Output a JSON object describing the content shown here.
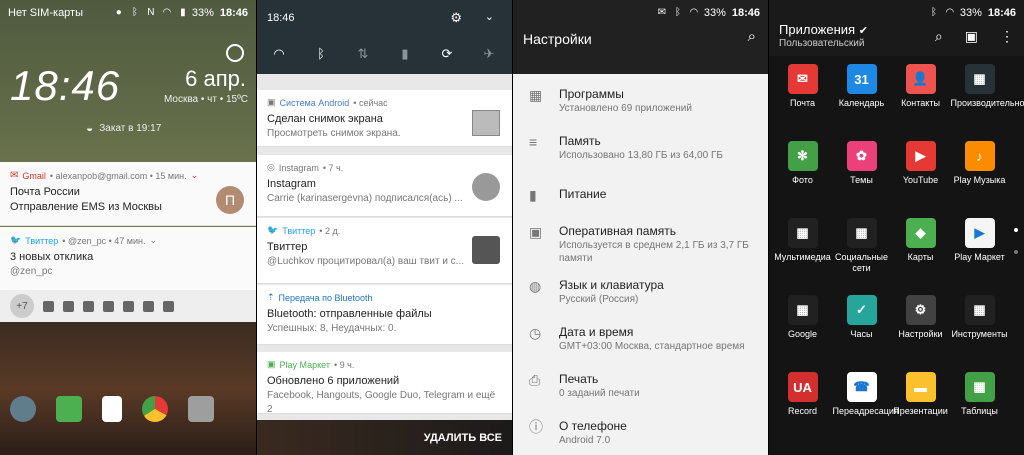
{
  "lock": {
    "status_left": "Нет SIM-карты",
    "battery": "33%",
    "time": "18:46",
    "clock": "18:46",
    "date": "6 апр.",
    "location": "Москва • чт • 15ºC",
    "sunset": "Закат в 19:17",
    "gmail": {
      "app": "Gmail",
      "meta": "• alexanpob@gmail.com • 15 мин.",
      "title": "Почта России",
      "text": "Отправление EMS из Москвы",
      "avatar": "П"
    },
    "twitter": {
      "app": "Твиттер",
      "meta": "• @zen_pc • 47 мин.",
      "title": "3 новых отклика",
      "text": "@zen_pc"
    },
    "more_count": "+7"
  },
  "shade": {
    "time": "18:46",
    "notifications": [
      {
        "app": "Система Android",
        "meta": "• сейчас",
        "title": "Сделан снимок экрана",
        "text": "Просмотреть снимок экрана."
      },
      {
        "app": "Instagram",
        "meta": "• 7 ч.",
        "title": "Instagram",
        "text": "Carrie (karinasergevna) подписался(ась) ..."
      },
      {
        "app": "Твиттер",
        "meta": "• 2 д.",
        "title": "Твиттер",
        "text": "@Luchkov процитировал(а) ваш твит и с..."
      },
      {
        "app": "Передача по Bluetooth",
        "meta": "",
        "title": "Bluetooth: отправленные файлы",
        "text": "Успешных: 8, Неудачных: 0."
      },
      {
        "app": "Play Маркет",
        "meta": "• 9 ч.",
        "title": "Обновлено 6 приложений",
        "text": "Facebook, Hangouts, Google Duo, Telegram и ещё 2"
      }
    ],
    "clear_all": "УДАЛИТЬ ВСЕ"
  },
  "settings": {
    "battery": "33%",
    "time": "18:46",
    "title": "Настройки",
    "items": [
      {
        "title": "Программы",
        "sub": "Установлено 69 приложений"
      },
      {
        "title": "Память",
        "sub": "Использовано 13,80 ГБ из 64,00 ГБ"
      },
      {
        "title": "Питание",
        "sub": ""
      },
      {
        "title": "Оперативная память",
        "sub": "Используется в среднем 2,1 ГБ из 3,7 ГБ памяти"
      },
      {
        "title": "Язык и клавиатура",
        "sub": "Русский (Россия)"
      },
      {
        "title": "Дата и время",
        "sub": "GMT+03:00 Москва, стандартное время"
      },
      {
        "title": "Печать",
        "sub": "0 заданий печати"
      },
      {
        "title": "О телефоне",
        "sub": "Android 7.0"
      }
    ]
  },
  "apps": {
    "battery": "33%",
    "time": "18:46",
    "title": "Приложения",
    "subtitle": "Пользовательский",
    "list": [
      {
        "label": "Почта",
        "color": "#e53935",
        "glyph": "✉"
      },
      {
        "label": "Календарь",
        "color": "#1e88e5",
        "glyph": "31"
      },
      {
        "label": "Контакты",
        "color": "#ef5350",
        "glyph": "👤"
      },
      {
        "label": "Производительность",
        "color": "#263238",
        "glyph": "▦"
      },
      {
        "label": "Фото",
        "color": "#43a047",
        "glyph": "✻"
      },
      {
        "label": "Темы",
        "color": "#ec407a",
        "glyph": "✿"
      },
      {
        "label": "YouTube",
        "color": "#e53935",
        "glyph": "▶"
      },
      {
        "label": "Play Музыка",
        "color": "#fb8c00",
        "glyph": "♪"
      },
      {
        "label": "Мультимедиа",
        "color": "#212121",
        "glyph": "▦"
      },
      {
        "label": "Социальные сети",
        "color": "#212121",
        "glyph": "▦"
      },
      {
        "label": "Карты",
        "color": "#4caf50",
        "glyph": "◆"
      },
      {
        "label": "Play Маркет",
        "color": "#f5f5f5",
        "glyph": "▶"
      },
      {
        "label": "Google",
        "color": "#212121",
        "glyph": "▦"
      },
      {
        "label": "Часы",
        "color": "#26a69a",
        "glyph": "✓"
      },
      {
        "label": "Настройки",
        "color": "#424242",
        "glyph": "⚙"
      },
      {
        "label": "Инструменты",
        "color": "#212121",
        "glyph": "▦"
      },
      {
        "label": "Record",
        "color": "#d32f2f",
        "glyph": "UA"
      },
      {
        "label": "Переадресация",
        "color": "#ffffff",
        "glyph": "☎"
      },
      {
        "label": "Презентации",
        "color": "#fbc02d",
        "glyph": "▬"
      },
      {
        "label": "Таблицы",
        "color": "#43a047",
        "glyph": "▦"
      }
    ]
  }
}
